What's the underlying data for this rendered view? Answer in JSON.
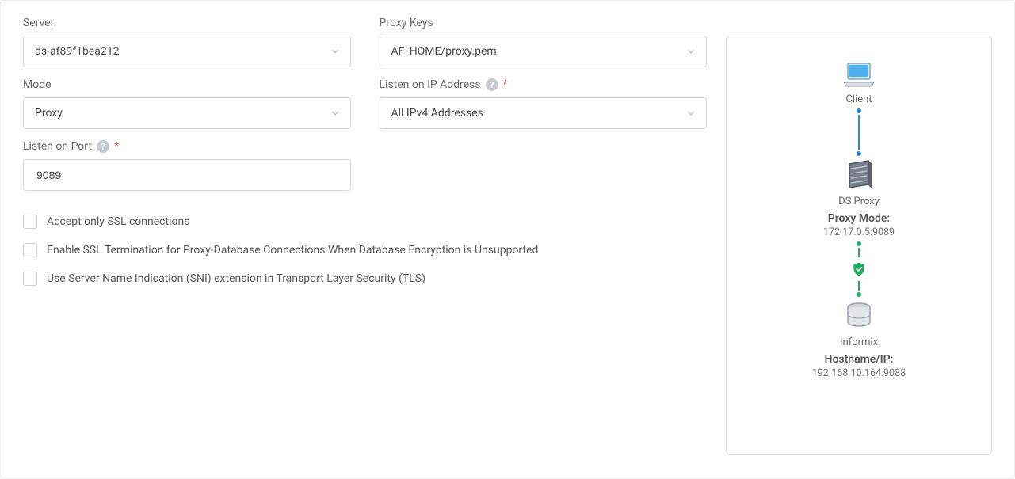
{
  "form": {
    "server": {
      "label": "Server",
      "value": "ds-af89f1bea212"
    },
    "proxy_keys": {
      "label": "Proxy Keys",
      "value": "AF_HOME/proxy.pem"
    },
    "mode": {
      "label": "Mode",
      "value": "Proxy"
    },
    "listen_ip": {
      "label": "Listen on IP Address",
      "value": "All IPv4 Addresses",
      "required": true
    },
    "listen_port": {
      "label": "Listen on Port",
      "value": "9089",
      "required": true
    }
  },
  "checkboxes": {
    "ssl_only": "Accept only SSL connections",
    "ssl_term": "Enable SSL Termination for Proxy-Database Connections When Database Encryption is Unsupported",
    "sni": "Use Server Name Indication (SNI) extension in Transport Layer Security (TLS)"
  },
  "diagram": {
    "client_label": "Client",
    "proxy_label": "DS Proxy",
    "proxy_title": "Proxy Mode:",
    "proxy_sub": "172.17.0.5:9089",
    "db_label": "Informix",
    "db_title": "Hostname/IP:",
    "db_sub": "192.168.10.164:9088"
  }
}
